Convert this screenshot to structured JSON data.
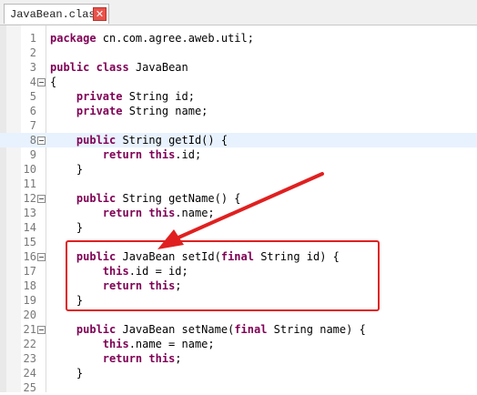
{
  "tab": {
    "title": "JavaBean.class",
    "close_icon": "close-icon"
  },
  "editor": {
    "lines": [
      {
        "n": "1",
        "code": "package cn.com.agree.aweb.util;",
        "fold": false,
        "current": false
      },
      {
        "n": "2",
        "code": "",
        "fold": false,
        "current": false
      },
      {
        "n": "3",
        "code": "public class JavaBean",
        "fold": false,
        "current": false
      },
      {
        "n": "4",
        "code": "{",
        "fold": true,
        "current": false
      },
      {
        "n": "5",
        "code": "    private String id;",
        "fold": false,
        "current": false
      },
      {
        "n": "6",
        "code": "    private String name;",
        "fold": false,
        "current": false
      },
      {
        "n": "7",
        "code": "",
        "fold": false,
        "current": false
      },
      {
        "n": "8",
        "code": "    public String getId() {",
        "fold": true,
        "current": true
      },
      {
        "n": "9",
        "code": "        return this.id;",
        "fold": false,
        "current": false
      },
      {
        "n": "10",
        "code": "    }",
        "fold": false,
        "current": false
      },
      {
        "n": "11",
        "code": "",
        "fold": false,
        "current": false
      },
      {
        "n": "12",
        "code": "    public String getName() {",
        "fold": true,
        "current": false
      },
      {
        "n": "13",
        "code": "        return this.name;",
        "fold": false,
        "current": false
      },
      {
        "n": "14",
        "code": "    }",
        "fold": false,
        "current": false
      },
      {
        "n": "15",
        "code": "",
        "fold": false,
        "current": false
      },
      {
        "n": "16",
        "code": "    public JavaBean setId(final String id) {",
        "fold": true,
        "current": false
      },
      {
        "n": "17",
        "code": "        this.id = id;",
        "fold": false,
        "current": false
      },
      {
        "n": "18",
        "code": "        return this;",
        "fold": false,
        "current": false
      },
      {
        "n": "19",
        "code": "    }",
        "fold": false,
        "current": false
      },
      {
        "n": "20",
        "code": "",
        "fold": false,
        "current": false
      },
      {
        "n": "21",
        "code": "    public JavaBean setName(final String name) {",
        "fold": true,
        "current": false
      },
      {
        "n": "22",
        "code": "        this.name = name;",
        "fold": false,
        "current": false
      },
      {
        "n": "23",
        "code": "        return this;",
        "fold": false,
        "current": false
      },
      {
        "n": "24",
        "code": "    }",
        "fold": false,
        "current": false
      },
      {
        "n": "25",
        "code": "",
        "fold": false,
        "current": false
      }
    ],
    "keywords": [
      "package",
      "public",
      "class",
      "private",
      "return",
      "this",
      "final"
    ]
  },
  "annotation": {
    "box_color": "#e02020",
    "arrow_color": "#e02020"
  },
  "colors": {
    "keyword": "#7f0055",
    "current_line": "#e8f2fe"
  }
}
